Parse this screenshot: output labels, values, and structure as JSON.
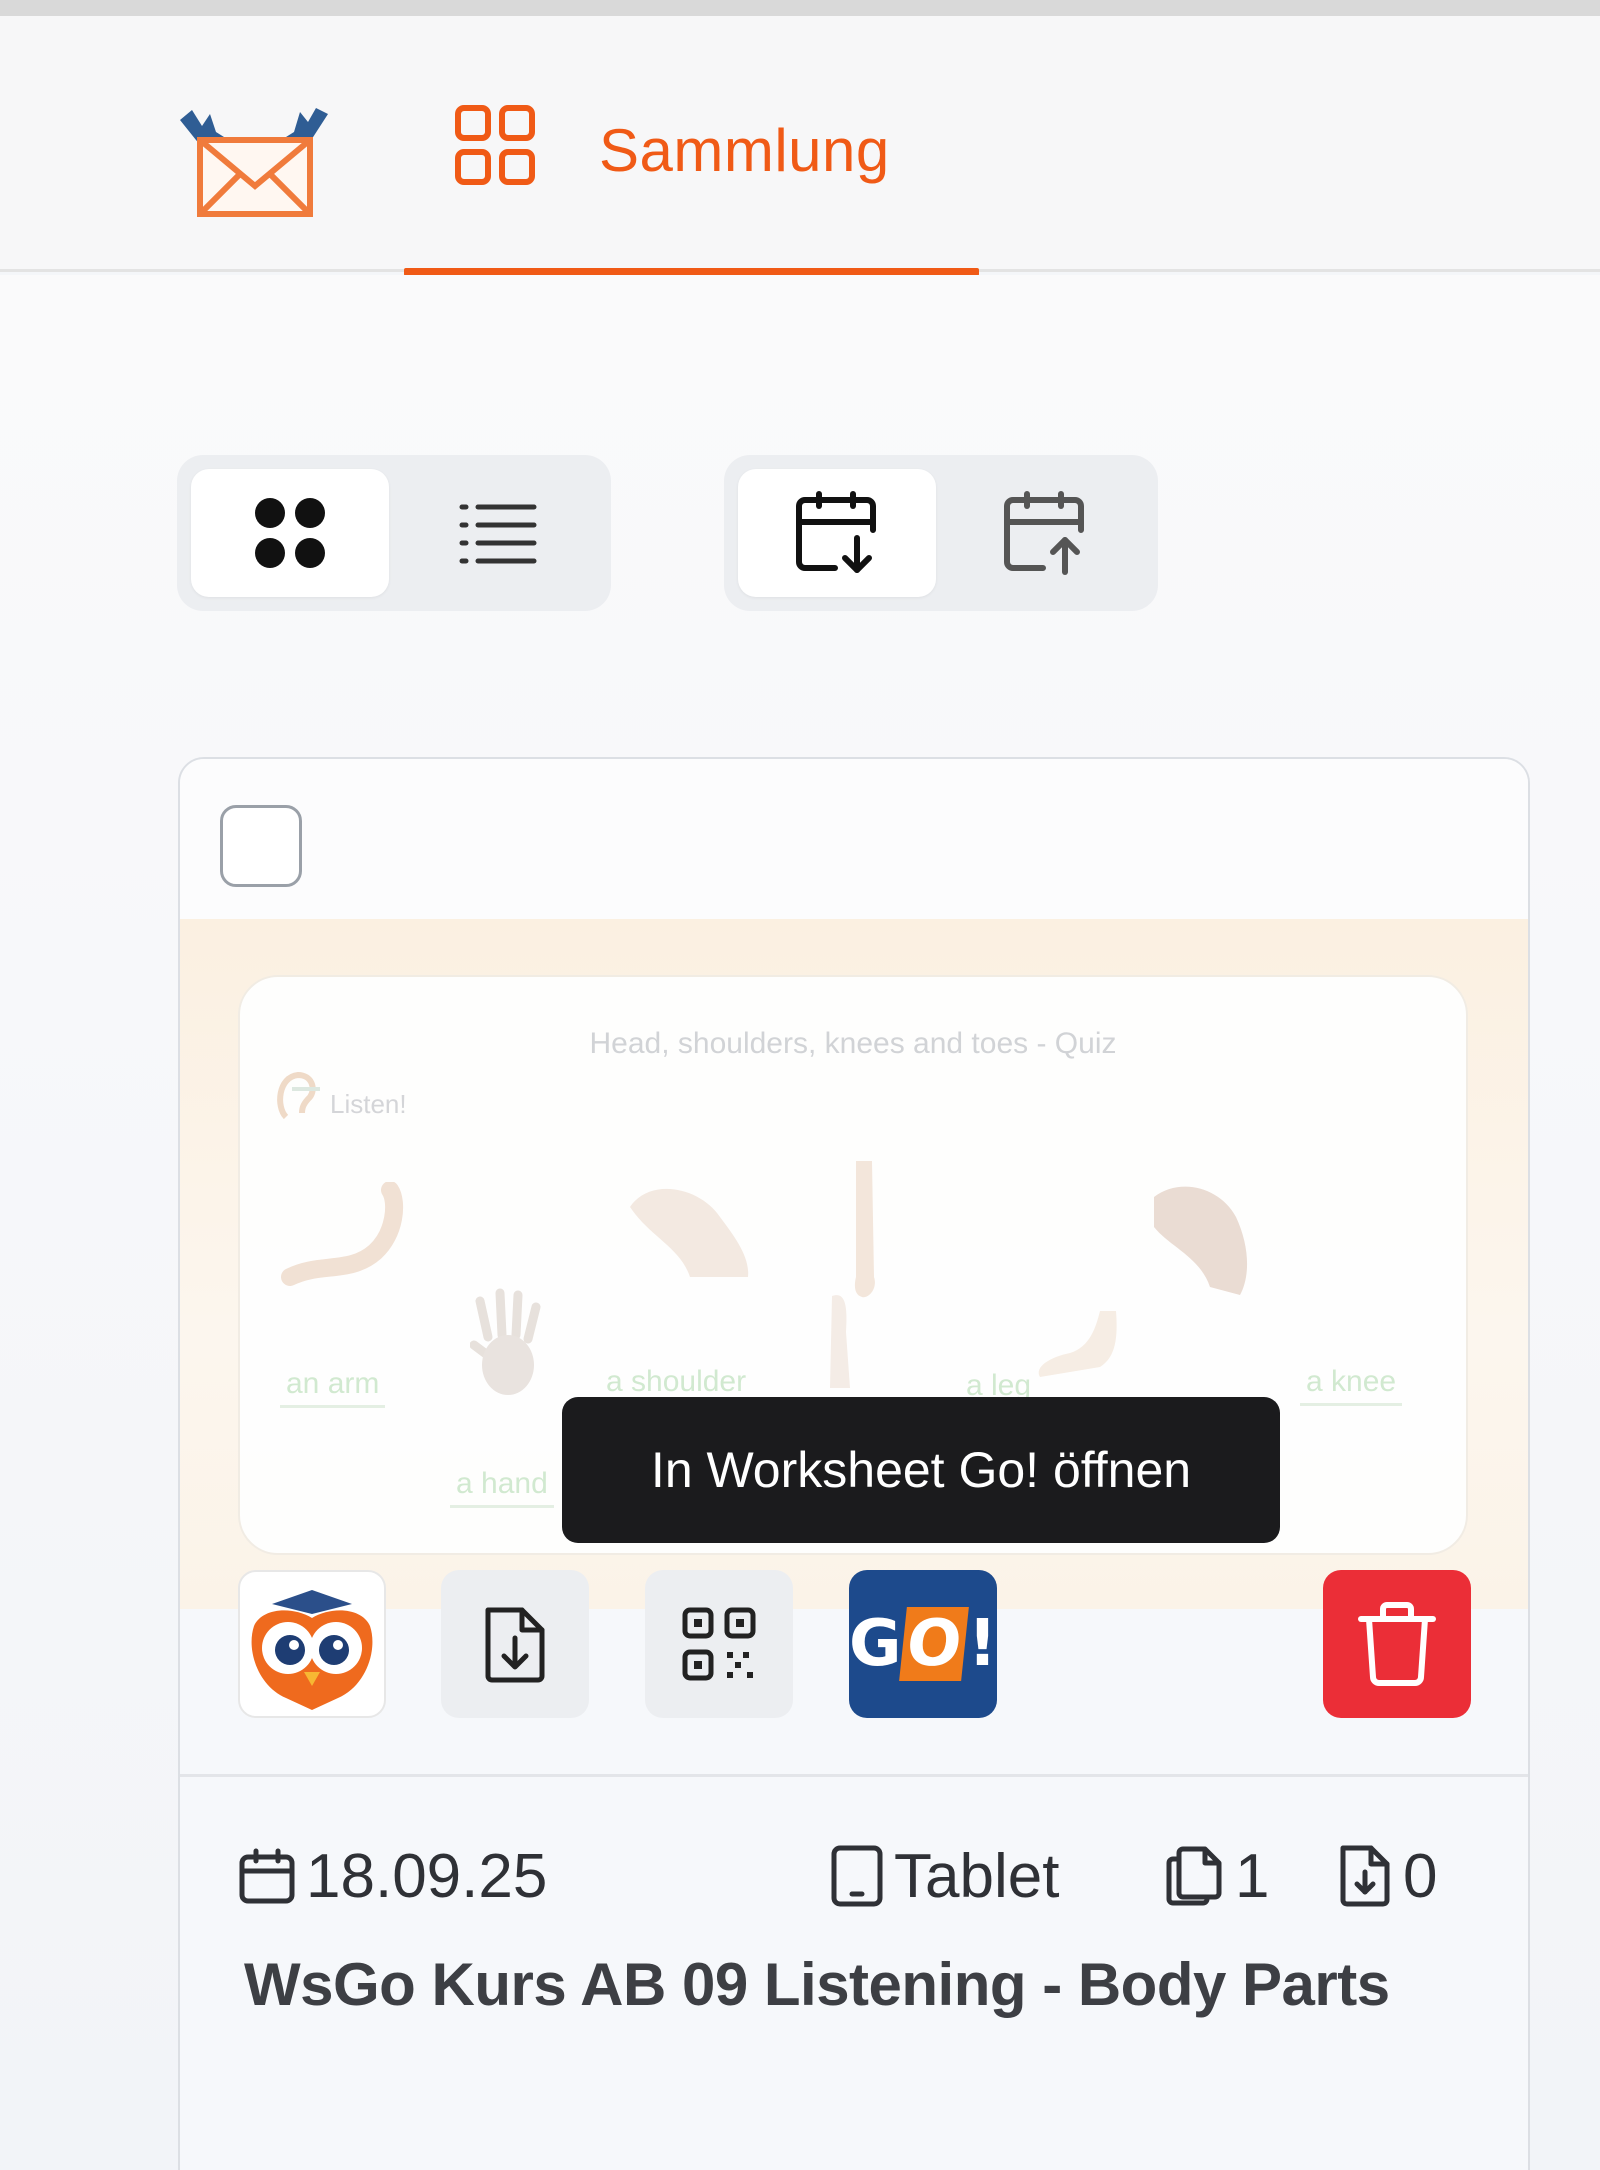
{
  "nav": {
    "active_tab_label": "Sammlung"
  },
  "toolbar": {
    "view_toggle": [
      "grid-view",
      "list-view"
    ],
    "sort_toggle": [
      "sort-date-descending",
      "sort-date-ascending"
    ]
  },
  "card": {
    "preview": {
      "title": "Head, shoulders, knees and toes - Quiz",
      "instruction": "Listen!",
      "words": [
        "an arm",
        "a shoulder",
        "a leg",
        "a knee",
        "a hand"
      ]
    },
    "tooltip": "In Worksheet Go! öffnen",
    "go_label_left": "G",
    "go_label_o": "O",
    "go_label_right": "!",
    "date": "18.09.25",
    "device": "Tablet",
    "pages": "1",
    "downloads": "0",
    "title": "WsGo Kurs AB 09 Listening - Body Parts"
  },
  "colors": {
    "accent": "#f05a16",
    "delete": "#eb2e37",
    "go_blue": "#1d4a8c"
  }
}
